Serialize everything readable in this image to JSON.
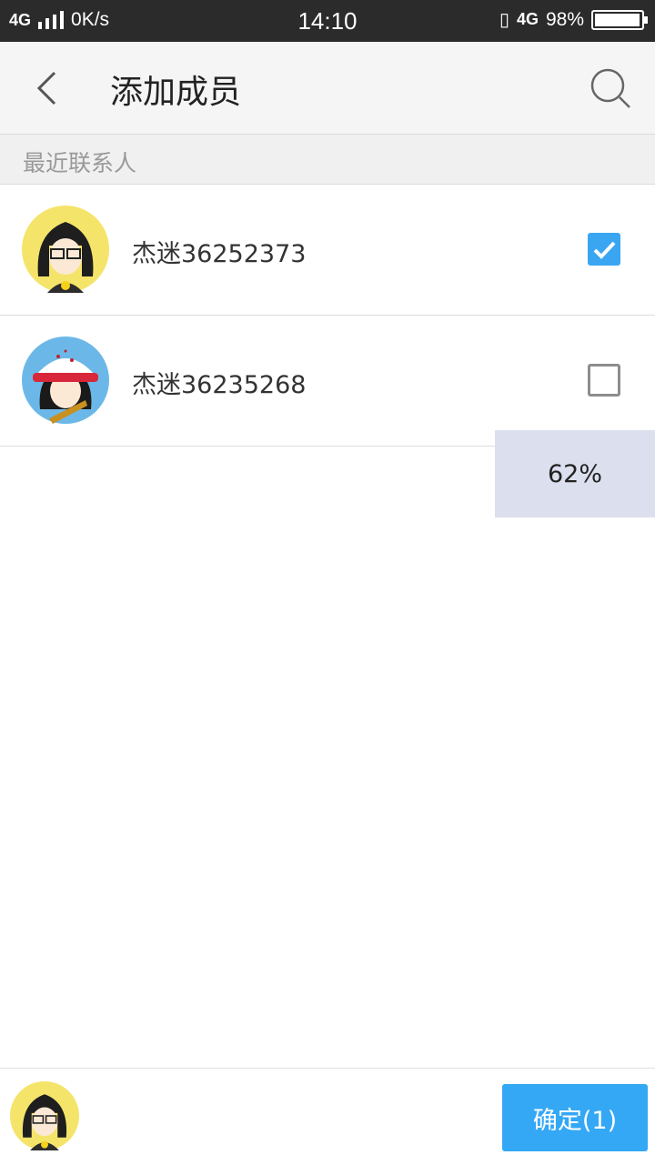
{
  "status_bar": {
    "network": "4G",
    "speed": "0K/s",
    "time": "14:10",
    "network_right": "4G",
    "battery": "98%",
    "battery_level": 0.98
  },
  "header": {
    "title": "添加成员",
    "back_icon": "chevron-left-icon",
    "search_icon": "search-icon"
  },
  "section": {
    "label": "最近联系人"
  },
  "contacts": [
    {
      "name": "杰迷36252373",
      "checked": true,
      "avatar": "cartoon-girl-glasses"
    },
    {
      "name": "杰迷36235268",
      "checked": false,
      "avatar": "cartoon-girl-red-cap"
    }
  ],
  "progress_tip": {
    "text": "62%"
  },
  "bottom": {
    "selected_avatar": "cartoon-girl-glasses",
    "confirm_label": "确定(1)"
  },
  "colors": {
    "accent": "#34a8f5",
    "status_bar": "#2b2b2b",
    "header_bg": "#f5f5f5",
    "tip_bg": "#dcdfee"
  }
}
